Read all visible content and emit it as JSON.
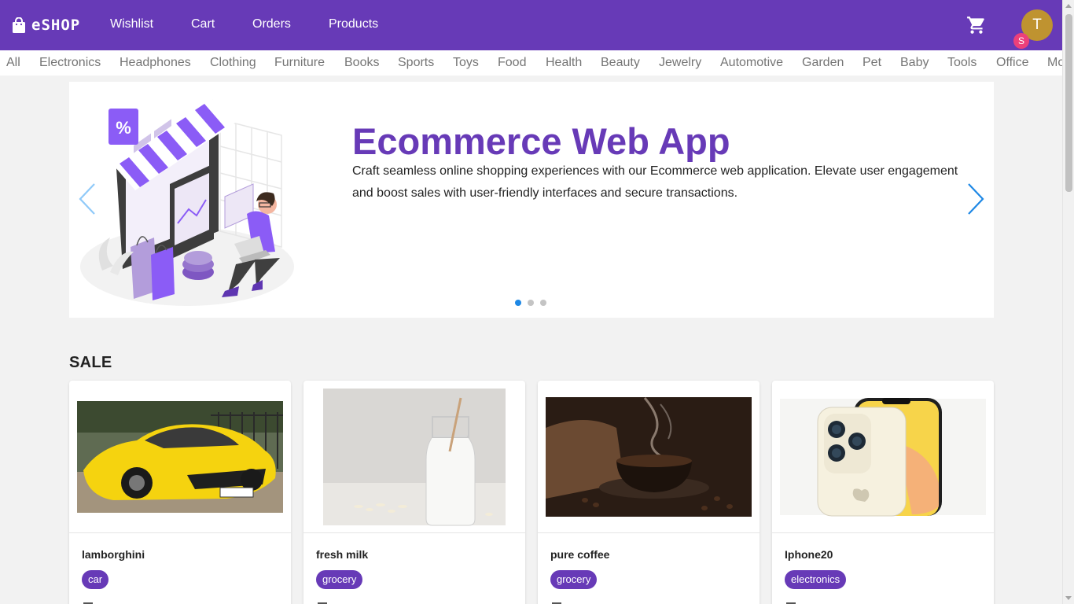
{
  "header": {
    "brand": "eSHOP",
    "nav": [
      {
        "label": "Wishlist"
      },
      {
        "label": "Cart"
      },
      {
        "label": "Orders"
      },
      {
        "label": "Products"
      }
    ],
    "cart_icon": "shopping-cart-icon",
    "avatar_initial": "T",
    "avatar_badge": "S",
    "brand_color": "#673ab7",
    "avatar_color": "#bf9330",
    "badge_color": "#ec407a"
  },
  "categories": [
    "All",
    "Electronics",
    "Headphones",
    "Clothing",
    "Furniture",
    "Books",
    "Sports",
    "Toys",
    "Food",
    "Health",
    "Beauty",
    "Jewelry",
    "Automotive",
    "Garden",
    "Pet",
    "Baby",
    "Tools",
    "Office",
    "Mo"
  ],
  "hero": {
    "title": "Ecommerce Web App",
    "description": "Craft seamless online shopping experiences with our Ecommerce web application. Elevate user engagement and boost sales with user-friendly interfaces and secure transactions.",
    "slide_count": 3,
    "active_slide": 1,
    "illustration_badge": "%",
    "prev_icon": "chevron-left-icon",
    "next_icon": "chevron-right-icon"
  },
  "sale": {
    "heading": "SALE",
    "products": [
      {
        "name": "lamborghini",
        "tag": "car",
        "image": "yellow-sports-car"
      },
      {
        "name": "fresh milk",
        "tag": "grocery",
        "image": "milk-bottle"
      },
      {
        "name": "pure coffee",
        "tag": "grocery",
        "image": "coffee-cup"
      },
      {
        "name": "Iphone20",
        "tag": "electronics",
        "image": "smartphone"
      }
    ]
  }
}
